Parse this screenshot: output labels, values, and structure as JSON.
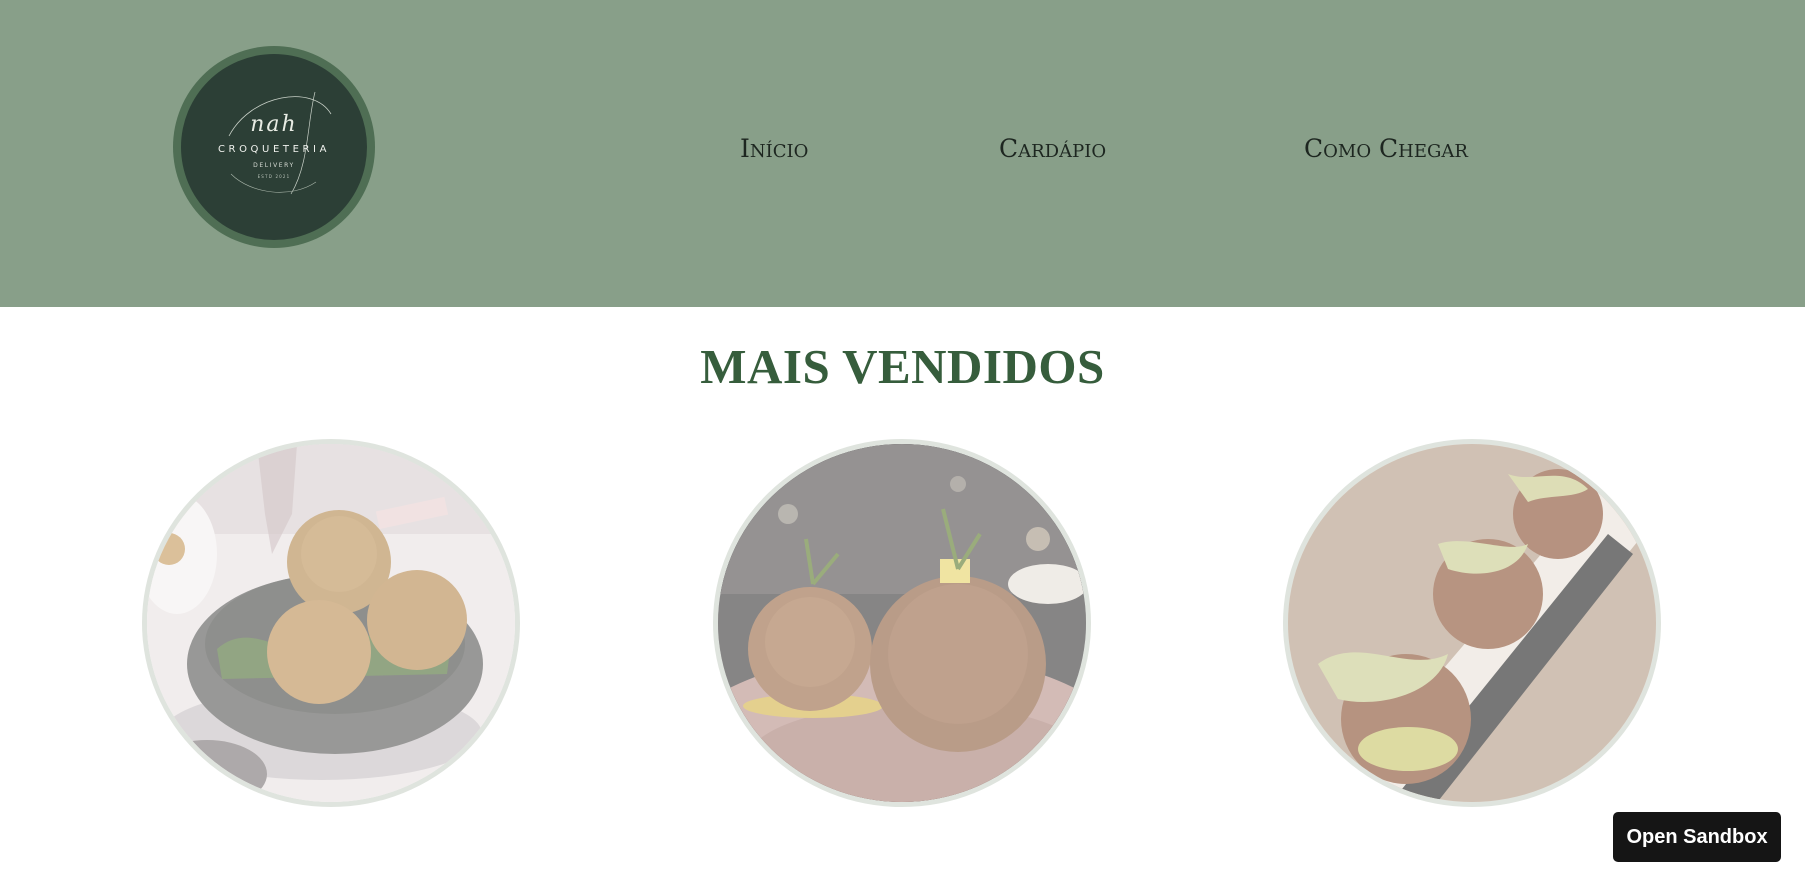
{
  "header": {
    "logo": {
      "script": "nah",
      "brand": "CROQUETERIA",
      "subtitle": "DELIVERY",
      "tagline": "ESTD 2021"
    },
    "nav": [
      "Início",
      "Cardápio",
      "Como Chegar"
    ]
  },
  "main": {
    "title": "MAIS VENDIDOS",
    "products": [
      {
        "icon": "croquettes-in-bowl-photo"
      },
      {
        "icon": "croquettes-on-plate-photo"
      },
      {
        "icon": "croquettes-on-slate-photo"
      }
    ]
  },
  "sandbox_button": {
    "label": "Open Sandbox"
  },
  "colors": {
    "header_bg": "#889f89",
    "logo_bg": "#2c3f36",
    "title": "#365d3c",
    "nav_text": "#1d2620"
  }
}
